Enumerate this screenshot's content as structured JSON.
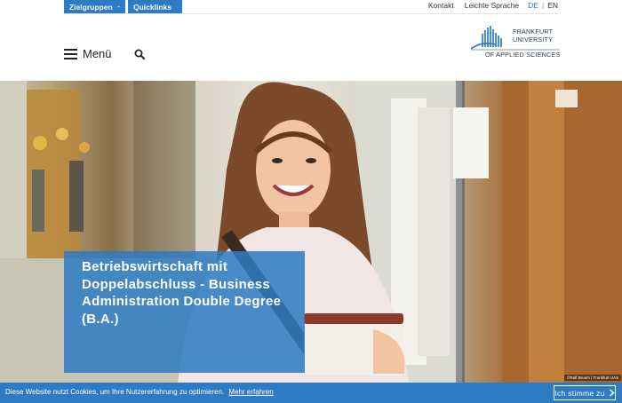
{
  "topbar": {
    "zielgruppen_label": "Zielgruppen",
    "quicklinks_label": "Quicklinks",
    "kontakt_label": "Kontakt",
    "leichte_sprache_label": "Leichte Sprache",
    "lang_de": "DE",
    "lang_sep": "|",
    "lang_en": "EN"
  },
  "header": {
    "menu_label": "Menü",
    "logo_line1": "FRANKFURT",
    "logo_line2": "UNIVERSITY",
    "logo_line3": "OF APPLIED SCIENCES"
  },
  "hero": {
    "title": "Betriebswirtschaft mit Doppelabschluss - Business Administration Double Degree (B.A.)",
    "photo_credit": "©Ralf Bruum | Frankfurt UAS"
  },
  "cookie": {
    "text": "Diese Website nutzt Cookies, um Ihre Nutzererfahrung zu optimieren.",
    "link_label": "Mehr erfahren",
    "accept_label": "Ich stimme zu"
  },
  "colors": {
    "accent": "#2d7bc4",
    "text": "#222222"
  },
  "icons": {
    "dropdown": "chevron-down-icon",
    "menu": "hamburger-icon",
    "search": "search-icon",
    "accept": "chevron-right-icon"
  }
}
